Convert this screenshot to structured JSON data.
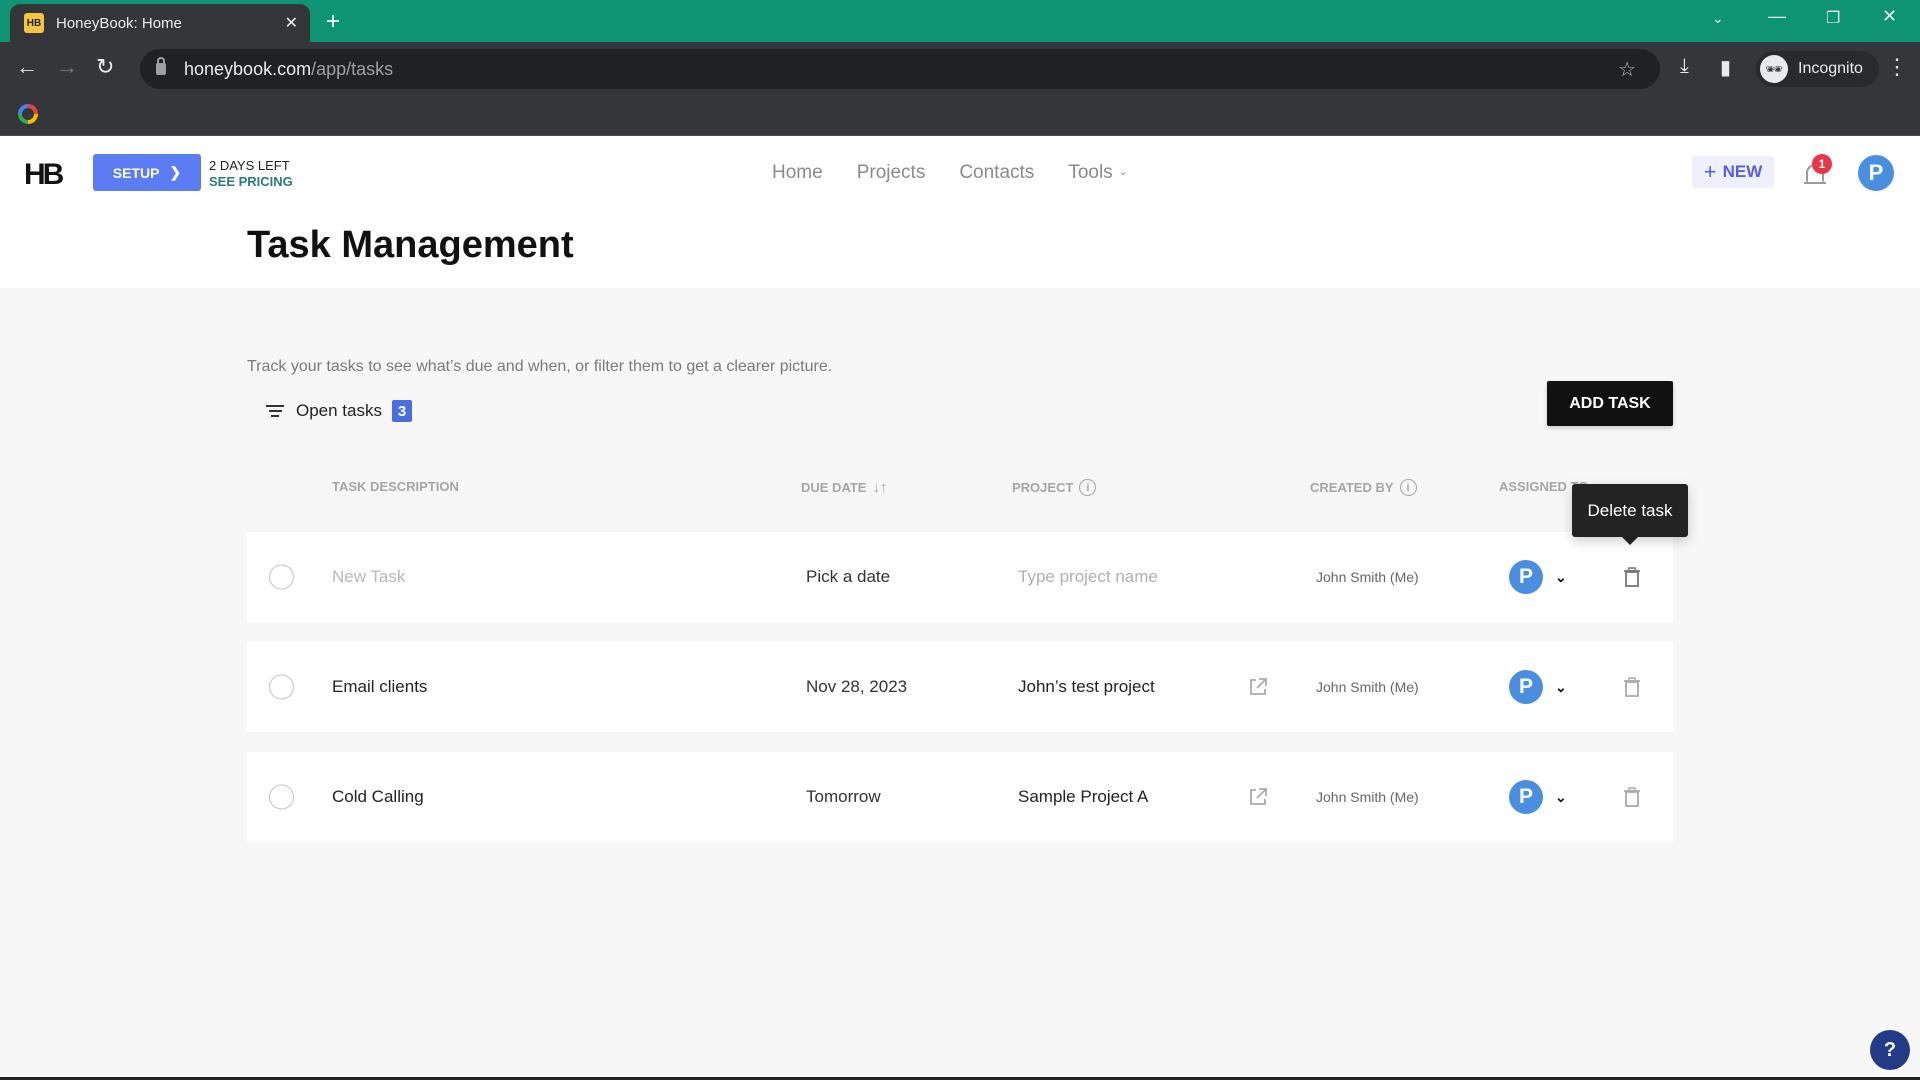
{
  "browser": {
    "tab_title": "HoneyBook: Home",
    "favicon_text": "HB",
    "url_host": "honeybook.com",
    "url_path": "/app/tasks",
    "profile_label": "Incognito"
  },
  "header": {
    "logo": "HB",
    "setup_label": "SETUP",
    "trial_days": "2 DAYS LEFT",
    "see_pricing": "SEE PRICING",
    "nav": [
      "Home",
      "Projects",
      "Contacts",
      "Tools"
    ],
    "new_label": "NEW",
    "notification_count": "1",
    "avatar_initial": "P"
  },
  "page": {
    "title": "Task Management",
    "description": "Track your tasks to see what’s due and when, or filter them to get a clearer picture.",
    "filter_label": "Open tasks",
    "filter_count": "3",
    "add_task_label": "ADD TASK"
  },
  "table": {
    "columns": {
      "task": "TASK DESCRIPTION",
      "due": "DUE DATE",
      "project": "PROJECT",
      "created_by": "CREATED BY",
      "assigned_to": "ASSIGNED TO"
    },
    "rows": [
      {
        "task": "New Task",
        "due": "Pick a date",
        "project": "Type project name",
        "created_by": "John Smith (Me)",
        "assignee": "P",
        "placeholder": true
      },
      {
        "task": "Email clients",
        "due": "Nov 28, 2023",
        "project": "John’s test project",
        "created_by": "John Smith (Me)",
        "assignee": "P",
        "placeholder": false
      },
      {
        "task": "Cold Calling",
        "due": "Tomorrow",
        "project": "Sample Project A",
        "created_by": "John Smith (Me)",
        "assignee": "P",
        "placeholder": false
      }
    ]
  },
  "tooltip": "Delete task",
  "help_label": "?"
}
